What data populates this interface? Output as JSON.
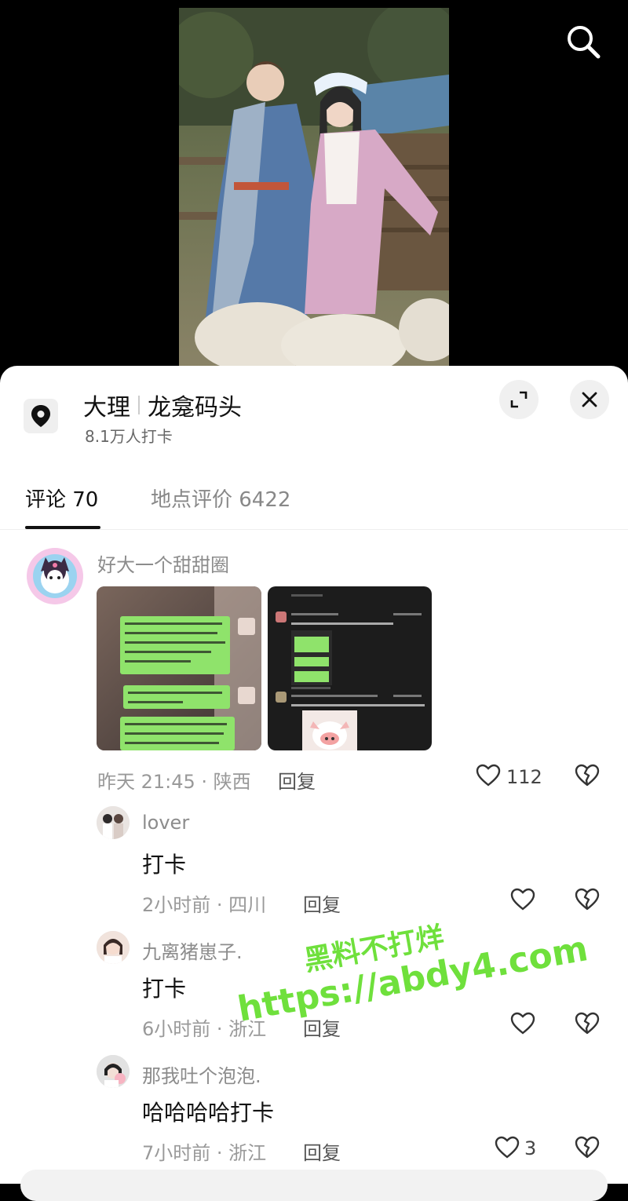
{
  "location": {
    "city": "大理",
    "place": "龙龛码头",
    "checkins": "8.1万人打卡"
  },
  "tabs": [
    {
      "label": "评论 70",
      "active": true
    },
    {
      "label": "地点评价 6422",
      "active": false
    }
  ],
  "comments": [
    {
      "user": "好大一个甜甜圈",
      "time_location": "昨天 21:45 · 陕西",
      "reply_label": "回复",
      "likes": "112"
    }
  ],
  "replies": [
    {
      "user": "lover",
      "text": "打卡",
      "time_location": "2小时前 · 四川",
      "reply_label": "回复",
      "likes": ""
    },
    {
      "user": "九离猪崽子.",
      "text": "打卡",
      "time_location": "6小时前 · 浙江",
      "reply_label": "回复",
      "likes": ""
    },
    {
      "user": "那我吐个泡泡.",
      "text": "哈哈哈哈打卡",
      "time_location": "7小时前 · 浙江",
      "reply_label": "回复",
      "likes": "3"
    }
  ],
  "watermark": {
    "line1": "黑料不打烊",
    "line2": "https://abdy4.com"
  },
  "colors": {
    "accent": "#111111",
    "bubble_green": "#8fe36b",
    "watermark_green": "#6fe03c"
  },
  "icons": [
    "search-icon",
    "location-pin-icon",
    "expand-icon",
    "close-icon",
    "heart-icon",
    "broken-heart-icon"
  ]
}
